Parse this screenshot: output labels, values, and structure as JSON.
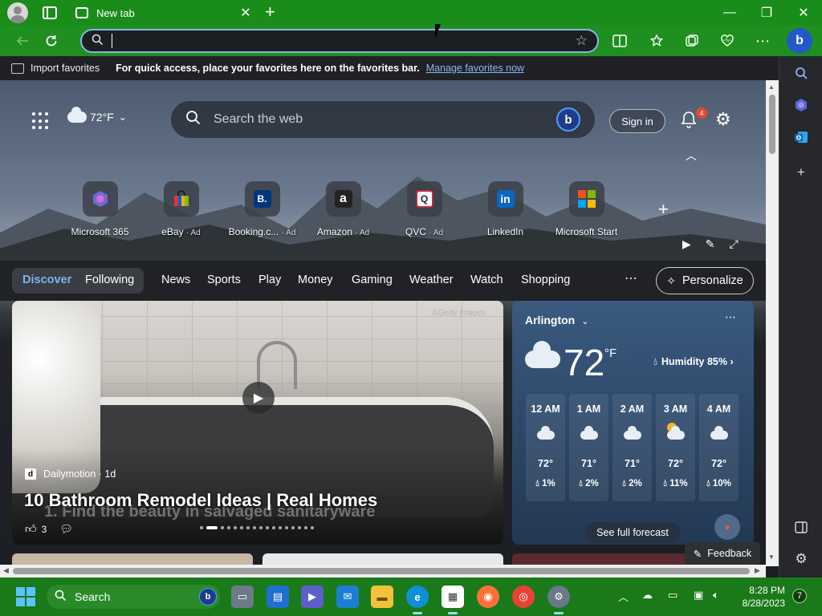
{
  "browser": {
    "tab_title": "New tab",
    "tab_close": "✕",
    "new_tab": "+",
    "window_controls": {
      "minimize": "—",
      "maximize": "❐",
      "close": "✕"
    },
    "address_value": "",
    "copilot": "b"
  },
  "favorites_bar": {
    "import_label": "Import favorites",
    "message": "For quick access, place your favorites here on the favorites bar.",
    "manage_link": "Manage favorites now"
  },
  "page": {
    "weather_temp": "72°F",
    "search_placeholder": "Search the web",
    "sign_in": "Sign in",
    "notification_count": "4",
    "quick_links": [
      {
        "name": "Microsoft 365",
        "ad": "",
        "logo_text": "",
        "logo_color": "#6b6bd6"
      },
      {
        "name": "eBay",
        "ad": "· Ad",
        "logo_text": "",
        "logo_color": "#e53238"
      },
      {
        "name": "Booking.c...",
        "ad": "· Ad",
        "logo_text": "B.",
        "logo_color": "#003580"
      },
      {
        "name": "Amazon",
        "ad": "· Ad",
        "logo_text": "a",
        "logo_color": "#222222"
      },
      {
        "name": "QVC",
        "ad": "· Ad",
        "logo_text": "Q",
        "logo_color": "#ffffff"
      },
      {
        "name": "LinkedIn",
        "ad": "",
        "logo_text": "in",
        "logo_color": "#0a66c2"
      },
      {
        "name": "Microsoft Start",
        "ad": "",
        "logo_text": "",
        "logo_color": "#f25022"
      }
    ],
    "categories": [
      "Discover",
      "Following",
      "News",
      "Sports",
      "Play",
      "Money",
      "Gaming",
      "Weather",
      "Watch",
      "Shopping"
    ],
    "personalize": "Personalize",
    "feedback": "Feedback"
  },
  "hero": {
    "watermark": "©Getty Images",
    "source": "Dailymotion · 1d",
    "source_logo": "d",
    "title": "10 Bathroom Remodel Ideas | Real Homes",
    "subtitle": "1. Find the beauty in salvaged sanitaryware",
    "likes": "3"
  },
  "weather": {
    "location": "Arlington",
    "temp": "72",
    "unit": "°F",
    "humidity": "Humidity 85%",
    "hours": [
      {
        "time": "12 AM",
        "temp": "72°",
        "precip": "1%",
        "icon": "cloud"
      },
      {
        "time": "1 AM",
        "temp": "71°",
        "precip": "2%",
        "icon": "cloud"
      },
      {
        "time": "2 AM",
        "temp": "71°",
        "precip": "2%",
        "icon": "cloud"
      },
      {
        "time": "3 AM",
        "temp": "72°",
        "precip": "11%",
        "icon": "partly-cloudy"
      },
      {
        "time": "4 AM",
        "temp": "72°",
        "precip": "10%",
        "icon": "cloud"
      }
    ],
    "see_forecast": "See full forecast"
  },
  "taskbar": {
    "search_label": "Search",
    "time": "8:28 PM",
    "date": "8/28/2023",
    "notification_count": "7"
  },
  "colors": {
    "titlebar": "#1a8c1a",
    "accent_link": "#8ab4f8",
    "active_category": "#7fb2f0",
    "taskbar": "#1a7a1a"
  }
}
